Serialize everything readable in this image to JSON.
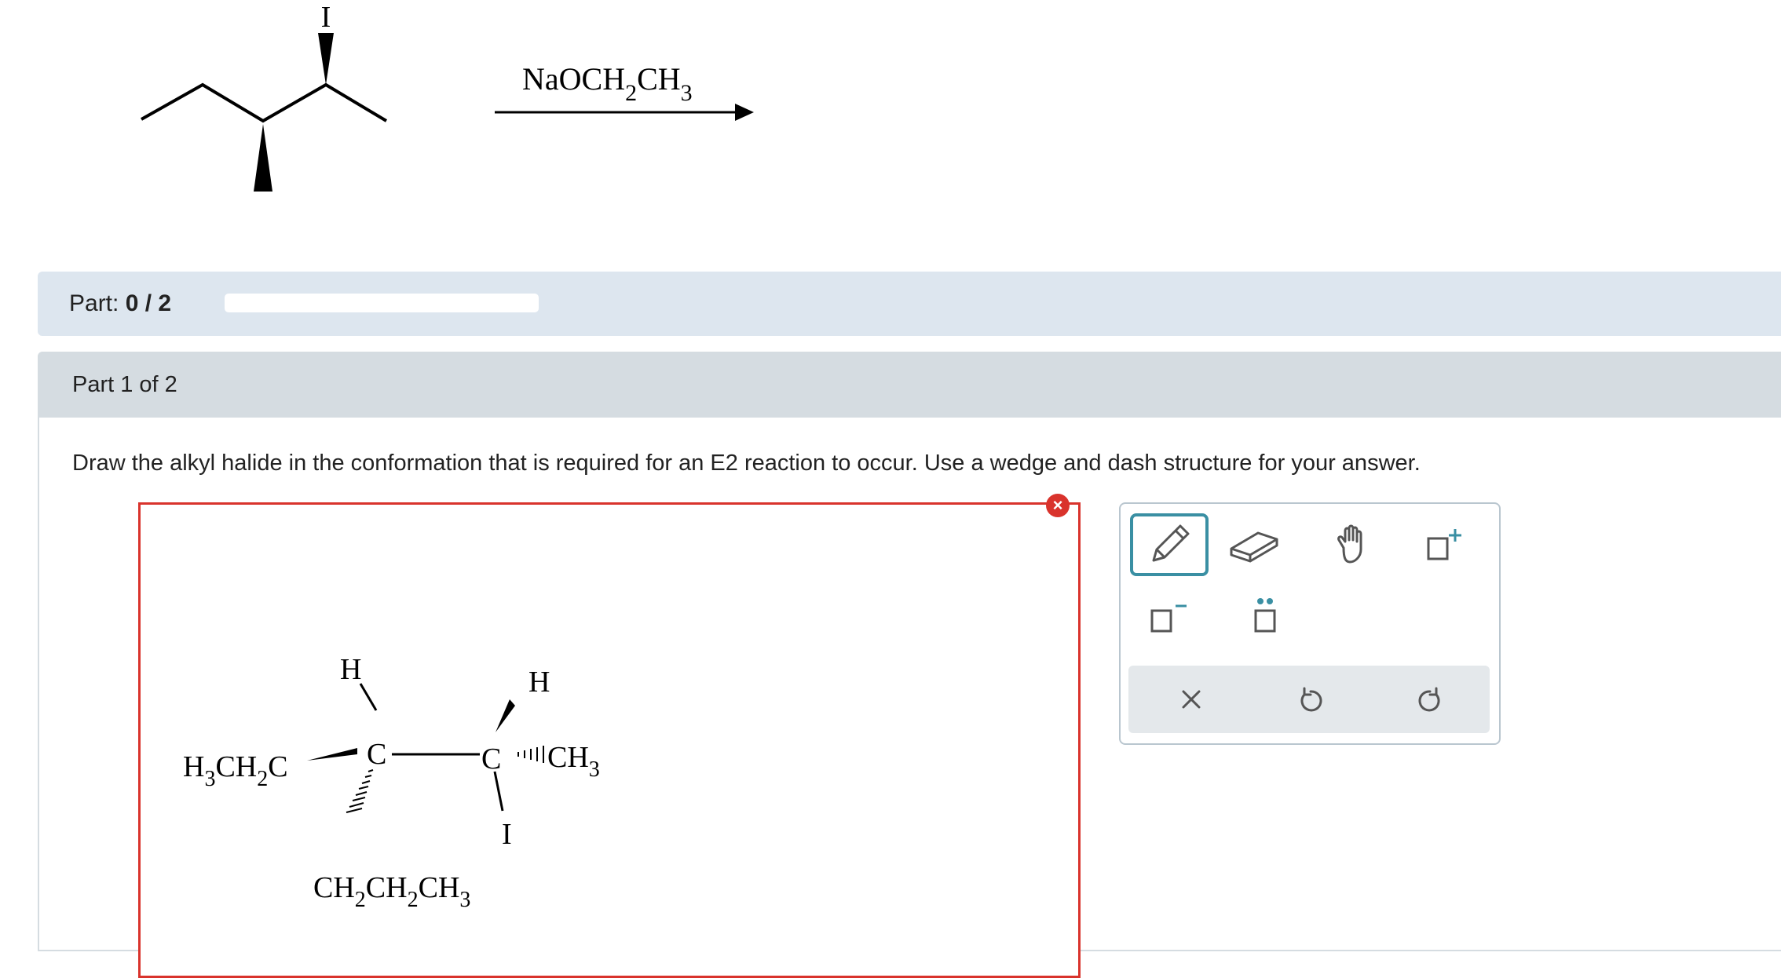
{
  "reaction": {
    "substituent_top": "I",
    "reagent_main": "NaOCH",
    "reagent_sub1": "2",
    "reagent_mid": "CH",
    "reagent_sub2": "3"
  },
  "progress": {
    "label": "Part:",
    "value": "0 / 2",
    "fraction": 0.0
  },
  "part": {
    "header": "Part 1 of 2",
    "question": "Draw the alkyl halide in the conformation that is required for an E2 reaction to occur. Use a wedge and dash structure for your answer."
  },
  "molecule": {
    "h_left": "H",
    "h_right": "H",
    "c_left": "C",
    "c_right": "C",
    "iodine": "I",
    "left_group": {
      "a": "H",
      "s1": "3",
      "b": "CH",
      "s2": "2",
      "c": "C"
    },
    "right_group": {
      "a": "CH",
      "s1": "3"
    },
    "bottom_group": {
      "a": "CH",
      "s1": "2",
      "b": "CH",
      "s2": "2",
      "c": "CH",
      "s3": "3"
    }
  },
  "toolbar": {
    "tools": [
      "pencil-icon",
      "eraser-icon",
      "hand-icon",
      "charge-plus-icon",
      "charge-minus-icon",
      "lone-pair-icon"
    ],
    "actions": [
      "clear-icon",
      "undo-icon",
      "redo-icon"
    ],
    "accent_color": "#3a8fa3",
    "error_color": "#d9332c"
  }
}
